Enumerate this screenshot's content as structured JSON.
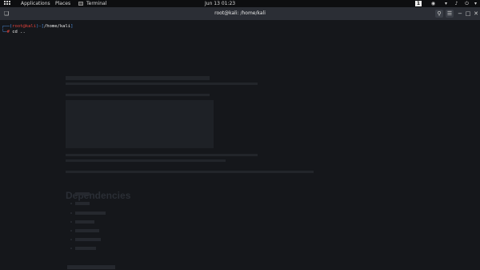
{
  "topbar": {
    "applications": "Applications",
    "places": "Places",
    "terminal": "Terminal",
    "clock": "Jun 13  01:23",
    "workspace": "1"
  },
  "window": {
    "title": "root@kali: /home/kali"
  },
  "terminal": {
    "prompt_user": "root",
    "prompt_at": "@",
    "prompt_host": "kali",
    "prompt_path": "/home/kali",
    "command": "cd .."
  },
  "background_doc": {
    "heading": "Dependencies"
  },
  "icons": {
    "apps": "apps-grid-icon",
    "terminal": "terminal-icon",
    "logo": "kali-dragon-logo",
    "tray_video": "camera-icon",
    "tray_network": "network-icon",
    "tray_volume": "volume-icon",
    "tray_power": "power-icon",
    "tray_menu": "chevron-down-icon",
    "new_tab": "new-tab-icon",
    "search": "search-icon",
    "menu": "hamburger-menu-icon",
    "minimize": "minimize-icon",
    "maximize": "maximize-icon",
    "close": "close-icon"
  }
}
